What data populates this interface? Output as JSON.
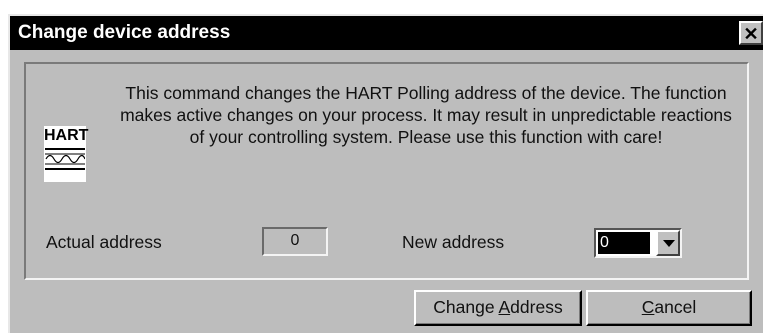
{
  "window": {
    "title": "Change device address",
    "close_glyph": "✕"
  },
  "logo": {
    "text": "HART",
    "icon": "hart-signal-icon"
  },
  "message": "This command changes the HART Polling address of the device. The function makes active changes on your process. It may result in unpredictable reactions of your controlling system. Please use this function with care!",
  "fields": {
    "actual_label": "Actual address",
    "actual_value": "0",
    "new_label": "New address",
    "new_value": "0"
  },
  "buttons": {
    "change_pre": "Change ",
    "change_accel": "A",
    "change_post": "ddress",
    "cancel_accel": "C",
    "cancel_post": "ancel"
  }
}
